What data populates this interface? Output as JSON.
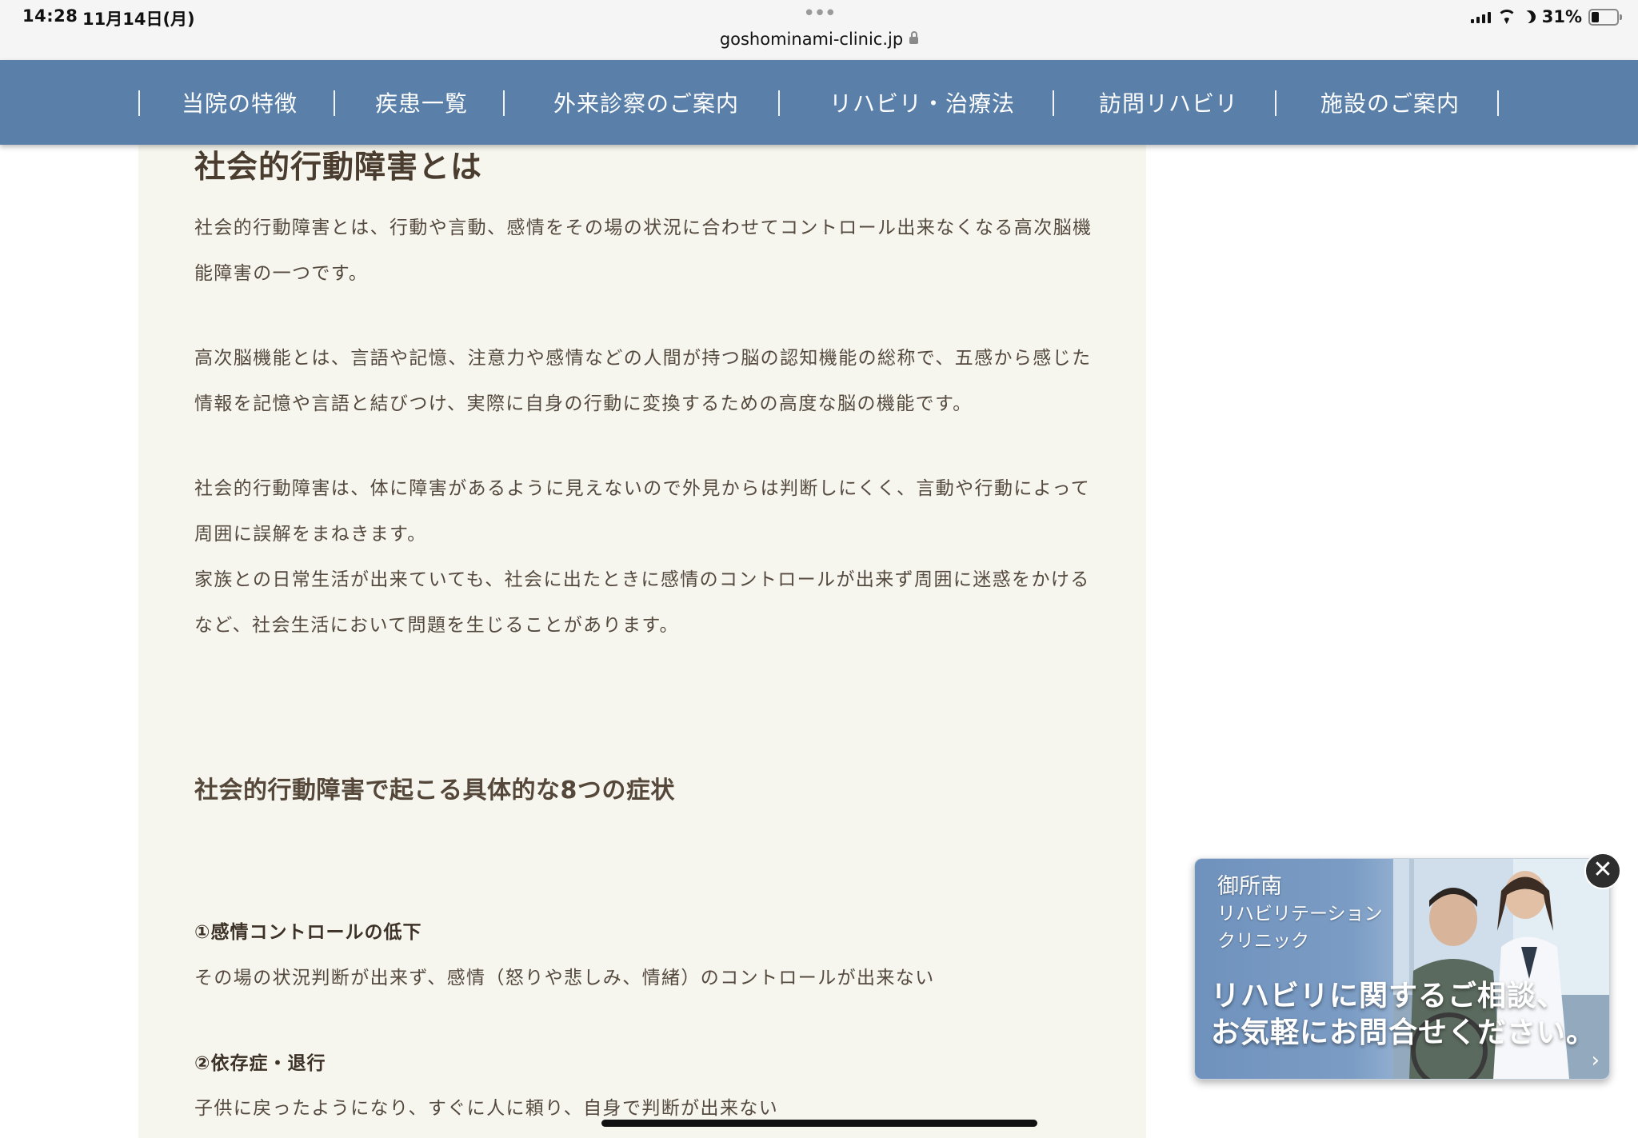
{
  "status_bar": {
    "time": "14:28",
    "date": "11月14日(月)",
    "url": "goshominami-clinic.jp",
    "battery": "31%",
    "battery_level": 0.31
  },
  "nav": {
    "items": [
      {
        "label": "当院の特徴"
      },
      {
        "label": "疾患一覧"
      },
      {
        "label": "外来診察のご案内"
      },
      {
        "label": "リハビリ・治療法"
      },
      {
        "label": "訪問リハビリ"
      },
      {
        "label": "施設のご案内"
      }
    ]
  },
  "article": {
    "heading": "社会的行動障害とは",
    "paragraphs": [
      "社会的行動障害とは、行動や言動、感情をその場の状況に合わせてコントロール出来なくなる高次脳機",
      "能障害の一つです。",
      "高次脳機能とは、言語や記憶、注意力や感情などの人間が持つ脳の認知機能の総称で、五感から感じた",
      "情報を記憶や言語と結びつけ、実際に自身の行動に変換するための高度な脳の機能です。",
      "社会的行動障害は、体に障害があるように見えないので外見からは判断しにくく、言動や行動によって",
      "周囲に誤解をまねきます。",
      "家族との日常生活が出来ていても、社会に出たときに感情のコントロールが出来ず周囲に迷惑をかける",
      "など、社会生活において問題を生じることがあります。"
    ],
    "subheading": "社会的行動障害で起こる具体的な8つの症状",
    "symptoms": [
      {
        "title": "①感情コントロールの低下",
        "desc": "その場の状況判断が出来ず、感情（怒りや悲しみ、情緒）のコントロールが出来ない"
      },
      {
        "title": "②依存症・退行",
        "desc": "子供に戻ったようになり、すぐに人に頼り、自身で判断が出来ない"
      }
    ]
  },
  "banner": {
    "clinic_line1": "御所南",
    "clinic_line2": "リハビリテーション",
    "clinic_line3": "クリニック",
    "cta_line1": "リハビリに関するご相談、",
    "cta_line2": "お気軽にお問合せください。",
    "close_glyph": "✕",
    "arrow_glyph": "›"
  }
}
